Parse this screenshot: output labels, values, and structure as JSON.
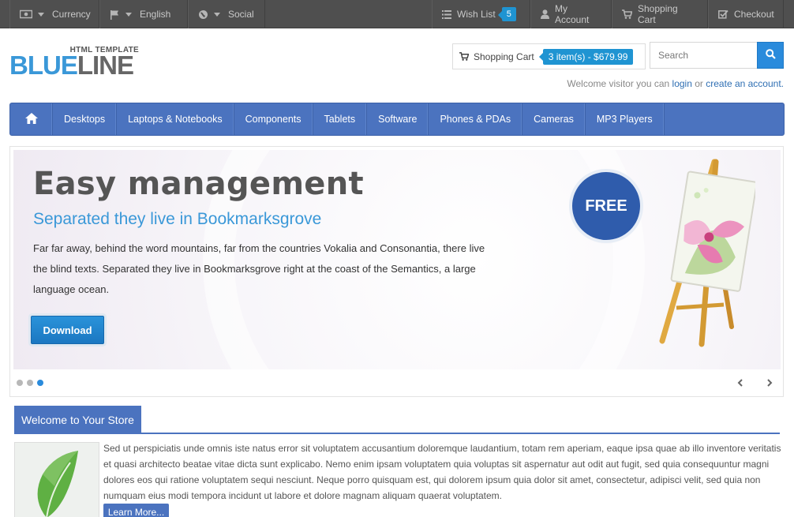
{
  "topbar": {
    "currency_label": "Currency",
    "language_label": "English",
    "social_label": "Social",
    "wishlist_label": "Wish List",
    "wishlist_count": "5",
    "account_label": "My Account",
    "cart_label": "Shopping Cart",
    "checkout_label": "Checkout"
  },
  "header": {
    "logo_sub": "HTML TEMPLATE",
    "logo_blue": "BLUE",
    "logo_grey": "LINE",
    "cart_label": "Shopping Cart",
    "cart_total": "3 item(s) - $679.99",
    "search_placeholder": "Search",
    "welcome_prefix": "Welcome visitor you can",
    "login_link": "login",
    "or_text": "or",
    "register_link": "create an account."
  },
  "nav": {
    "items": [
      "Desktops",
      "Laptops & Notebooks",
      "Components",
      "Tablets",
      "Software",
      "Phones & PDAs",
      "Cameras",
      "MP3 Players"
    ]
  },
  "slider": {
    "title": "Easy management",
    "subtitle": "Separated they live in Bookmarksgrove",
    "text": "Far far away, behind the word mountains, far from the countries Vokalia and Consonantia, there live the blind texts. Separated they live in Bookmarksgrove right at the coast of the Semantics, a large language ocean.",
    "button_label": "Download",
    "badge": "FREE"
  },
  "welcome": {
    "title": "Welcome to Your Store",
    "text": "Sed ut perspiciatis unde omnis iste natus error sit voluptatem accusantium doloremque laudantium, totam rem aperiam, eaque ipsa quae ab illo inventore veritatis et quasi architecto beatae vitae dicta sunt explicabo. Nemo enim ipsam voluptatem quia voluptas sit aspernatur aut odit aut fugit, sed quia consequuntur magni dolores eos qui ratione voluptatem sequi nesciunt. Neque porro quisquam est, qui dolorem ipsum quia dolor sit amet, consectetur, adipisci velit, sed quia non numquam eius modi tempora incidunt ut labore et dolore magnam aliquam quaerat voluptatem.",
    "button_label": "Learn More..."
  },
  "colors": {
    "brand_blue": "#4b73bf",
    "accent_blue": "#1f94d2",
    "topbar_bg": "#4f4f4f"
  }
}
